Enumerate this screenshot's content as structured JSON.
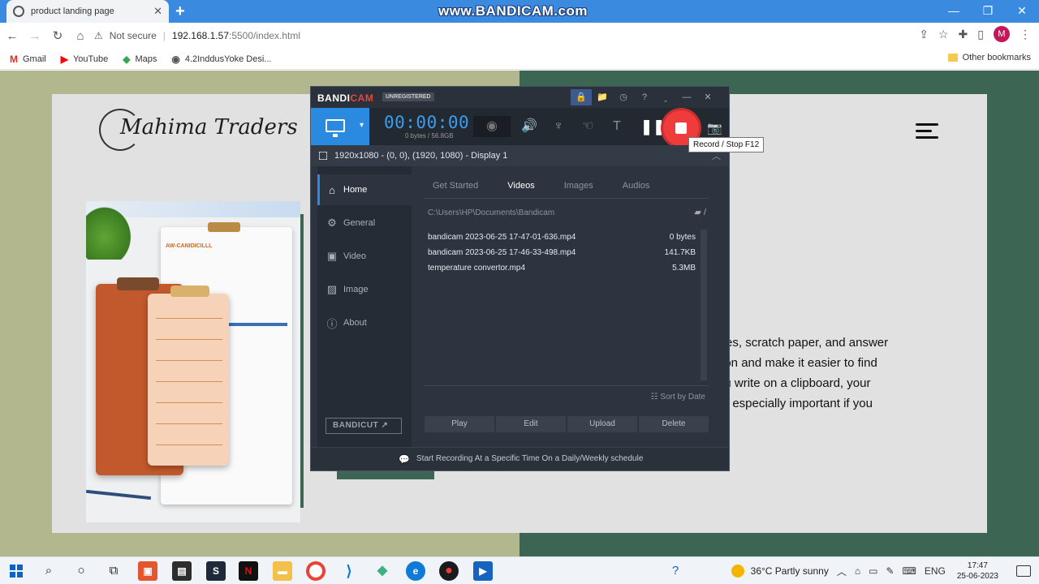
{
  "browser": {
    "tab_title": "product landing page",
    "tab_close": "✕",
    "new_tab": "+",
    "watermark": "www.BANDICAM.com",
    "window_controls": [
      "—",
      "❐",
      "✕"
    ],
    "omnibox": {
      "security_label": "Not secure",
      "host": "192.168.1.57",
      "path": ":5500/index.html"
    },
    "avatar_letter": "M",
    "bookmarks": [
      {
        "label": "Gmail",
        "icon": "gmail-icon",
        "glyph": "M",
        "color": "#d93025"
      },
      {
        "label": "YouTube",
        "icon": "youtube-icon",
        "glyph": "▶",
        "color": "#ff0000"
      },
      {
        "label": "Maps",
        "icon": "maps-icon",
        "glyph": "◆",
        "color": "#34a853"
      },
      {
        "label": "4.2InddusYoke Desi...",
        "icon": "globe-icon",
        "glyph": "◉",
        "color": "#555555"
      }
    ],
    "other_bookmarks": "Other bookmarks"
  },
  "page": {
    "logo_text": "Mahima Traders",
    "hero_text": "r notes, scratch paper, and answer\nmation and make it easier to find\nh you write on a clipboard, your\nhis is especially important if you",
    "image_label": "AW-CANIDICILLL"
  },
  "bandicam": {
    "logo_left": "BANDI",
    "logo_right": "CAM",
    "unregistered": "UNREGISTERED",
    "title_icons": [
      "🔒",
      "📁",
      "◷",
      "?",
      "‸",
      "—",
      "✕"
    ],
    "timer": "00:00:00",
    "size": "0 bytes / 56.8GB",
    "tooltip": "Record / Stop   F12",
    "target": "1920x1080 - (0, 0), (1920, 1080) - Display 1",
    "target_collapse": "︿",
    "nav": [
      {
        "label": "Home",
        "icon": "home-icon",
        "glyph": "⌂",
        "active": true
      },
      {
        "label": "General",
        "icon": "gear-icon",
        "glyph": "⚙",
        "active": false
      },
      {
        "label": "Video",
        "icon": "video-settings-icon",
        "glyph": "▣",
        "active": false
      },
      {
        "label": "Image",
        "icon": "image-settings-icon",
        "glyph": "▨",
        "active": false
      },
      {
        "label": "About",
        "icon": "info-icon",
        "glyph": "ⓘ",
        "active": false
      }
    ],
    "bandicut": "BANDICUT ↗",
    "tabs": [
      "Get Started",
      "Videos",
      "Images",
      "Audios"
    ],
    "active_tab": "Videos",
    "path": "C:\\Users\\HP\\Documents\\Bandicam",
    "files": [
      {
        "name": "bandicam 2023-06-25 17-47-01-636.mp4",
        "size": "0 bytes"
      },
      {
        "name": "bandicam 2023-06-25 17-46-33-498.mp4",
        "size": "141.7KB"
      },
      {
        "name": "temperature convertor.mp4",
        "size": "5.3MB"
      }
    ],
    "sort_label": "☷ Sort by Date",
    "actions": [
      "Play",
      "Edit",
      "Upload",
      "Delete"
    ],
    "footer": "Start Recording At a Specific Time On a Daily/Weekly schedule"
  },
  "taskbar": {
    "weather": "36°C  Partly sunny",
    "language": "ENG",
    "time": "17:47",
    "date": "25-06-2023"
  },
  "colors": {
    "bandicam_accent": "#2a8ae0",
    "record_red": "#ef3b3b",
    "page_green": "#3d6553",
    "page_olive": "#b3b78e"
  }
}
